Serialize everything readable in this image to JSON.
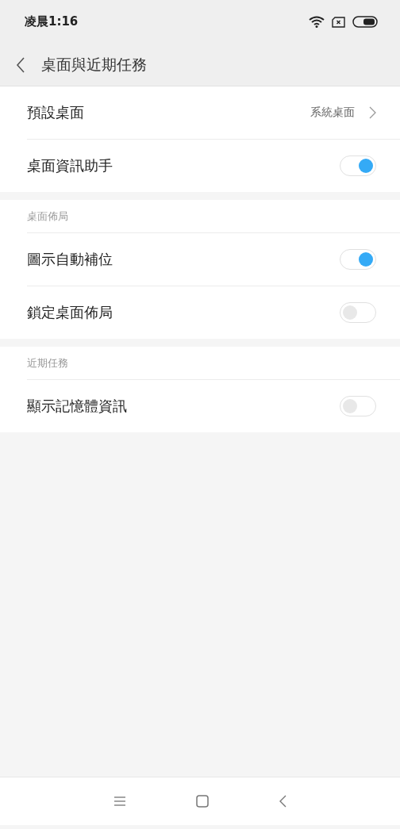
{
  "status_bar": {
    "time": "凌晨1:16"
  },
  "header": {
    "title": "桌面與近期任務"
  },
  "sections": [
    {
      "items": [
        {
          "kind": "link",
          "label": "預設桌面",
          "value": "系統桌面"
        },
        {
          "kind": "toggle",
          "label": "桌面資訊助手",
          "on": true
        }
      ]
    },
    {
      "header": "桌面佈局",
      "items": [
        {
          "kind": "toggle",
          "label": "圖示自動補位",
          "on": true
        },
        {
          "kind": "toggle",
          "label": "鎖定桌面佈局",
          "on": false
        }
      ]
    },
    {
      "header": "近期任務",
      "items": [
        {
          "kind": "toggle",
          "label": "顯示記憶體資訊",
          "on": false
        }
      ]
    }
  ]
}
